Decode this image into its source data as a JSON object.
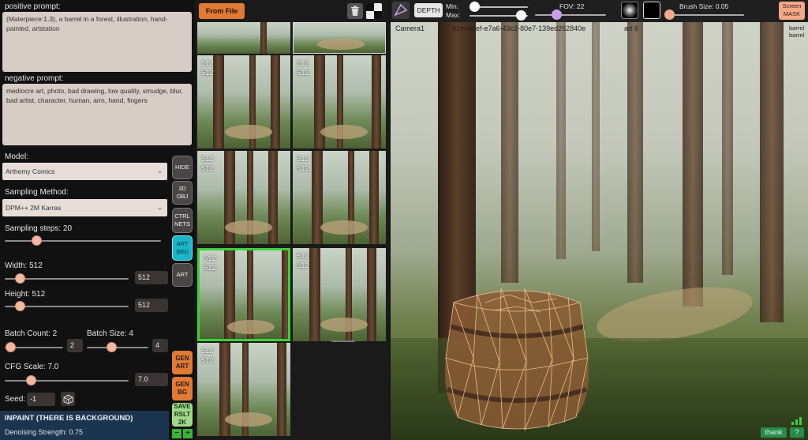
{
  "left_panel": {
    "positive_label": "positive prompt:",
    "positive_text": "(Materpiece:1.3), a barrel in a forest, illustration, hand-painted, artstation",
    "negative_label": "negative prompt:",
    "negative_text": "mediocre art, photo, bad drawing, low quality, smudge, blur, bad artist, character, human, arm, hand, fingers",
    "model_label": "Model:",
    "model_value": "Arthemy Comics",
    "sampling_label": "Sampling Method:",
    "sampling_value": "DPM++ 2M Karras",
    "steps_label": "Sampling steps:  20",
    "steps_level": 0.2,
    "width_label": "Width: 512",
    "width_value": "512",
    "width_level": 0.12,
    "height_label": "Height: 512",
    "height_value": "512",
    "height_level": 0.12,
    "batch_count_label": "Batch Count: 2",
    "batch_count_value": "2",
    "batch_count_level": 0.1,
    "batch_size_label": "Batch Size: 4",
    "batch_size_value": "4",
    "batch_size_level": 0.4,
    "cfg_label": "CFG Scale: 7.0",
    "cfg_value": "7.0",
    "cfg_level": 0.21,
    "seed_label": "Seed:",
    "seed_value": "-1",
    "inpaint_label": "INPAINT (THERE IS BACKGROUND)",
    "denoise_label": "Denoising Strength: 0.75"
  },
  "side_buttons": {
    "hide": "HIDE",
    "obj_3d": [
      "3D",
      "OBJ"
    ],
    "ctrl_nets": [
      "CTRL",
      "NETS"
    ],
    "art_bg": [
      "ART",
      "(BG)"
    ],
    "art": "ART",
    "gen_art": [
      "GEN",
      "ART"
    ],
    "gen_bg": [
      "GEN",
      "BG"
    ],
    "save": [
      "SAVE",
      "RSLT",
      "2K"
    ],
    "minus": "−",
    "plus": "+"
  },
  "gallery": {
    "from_file": "From File",
    "thumbs": [
      {
        "l1": "512",
        "l2": "512",
        "selected": false
      },
      {
        "l1": "512",
        "l2": "512",
        "selected": false
      },
      {
        "l1": "512",
        "l2": "512",
        "selected": false
      },
      {
        "l1": "512",
        "l2": "512",
        "selected": false
      },
      {
        "l1": "512",
        "l2": "512",
        "selected": true
      },
      {
        "l1": "512",
        "l2": "512",
        "selected": false
      },
      {
        "l1": "512",
        "l2": "512",
        "selected": false
      }
    ]
  },
  "toolbar": {
    "depth": "DEPTH",
    "min_label": "Min:",
    "max_label": "Max:",
    "min_level": 0.08,
    "max_level": 0.88,
    "fov_label": "FOV: 22",
    "fov_level": 0.3,
    "brush_label": "Brush Size: 0.05",
    "brush_level": 0.05,
    "screen_mask": [
      "Screen",
      "MASK"
    ]
  },
  "viewport": {
    "camera_label": "Camera1",
    "guid": "41ea66ef-e7a6-43c2-80e7-139ed262840e",
    "art_label": "art 6",
    "object_labels": [
      "barrel",
      "barrel"
    ],
    "thank_label": "thank",
    "help_label": "?"
  },
  "colors": {
    "accent_orange": "#e07a36",
    "selected_green": "#3bd13b",
    "art_bg_cyan": "#19b6c9",
    "fov_purple": "#c9a0e8",
    "brush_knob": "#f0a98a"
  }
}
